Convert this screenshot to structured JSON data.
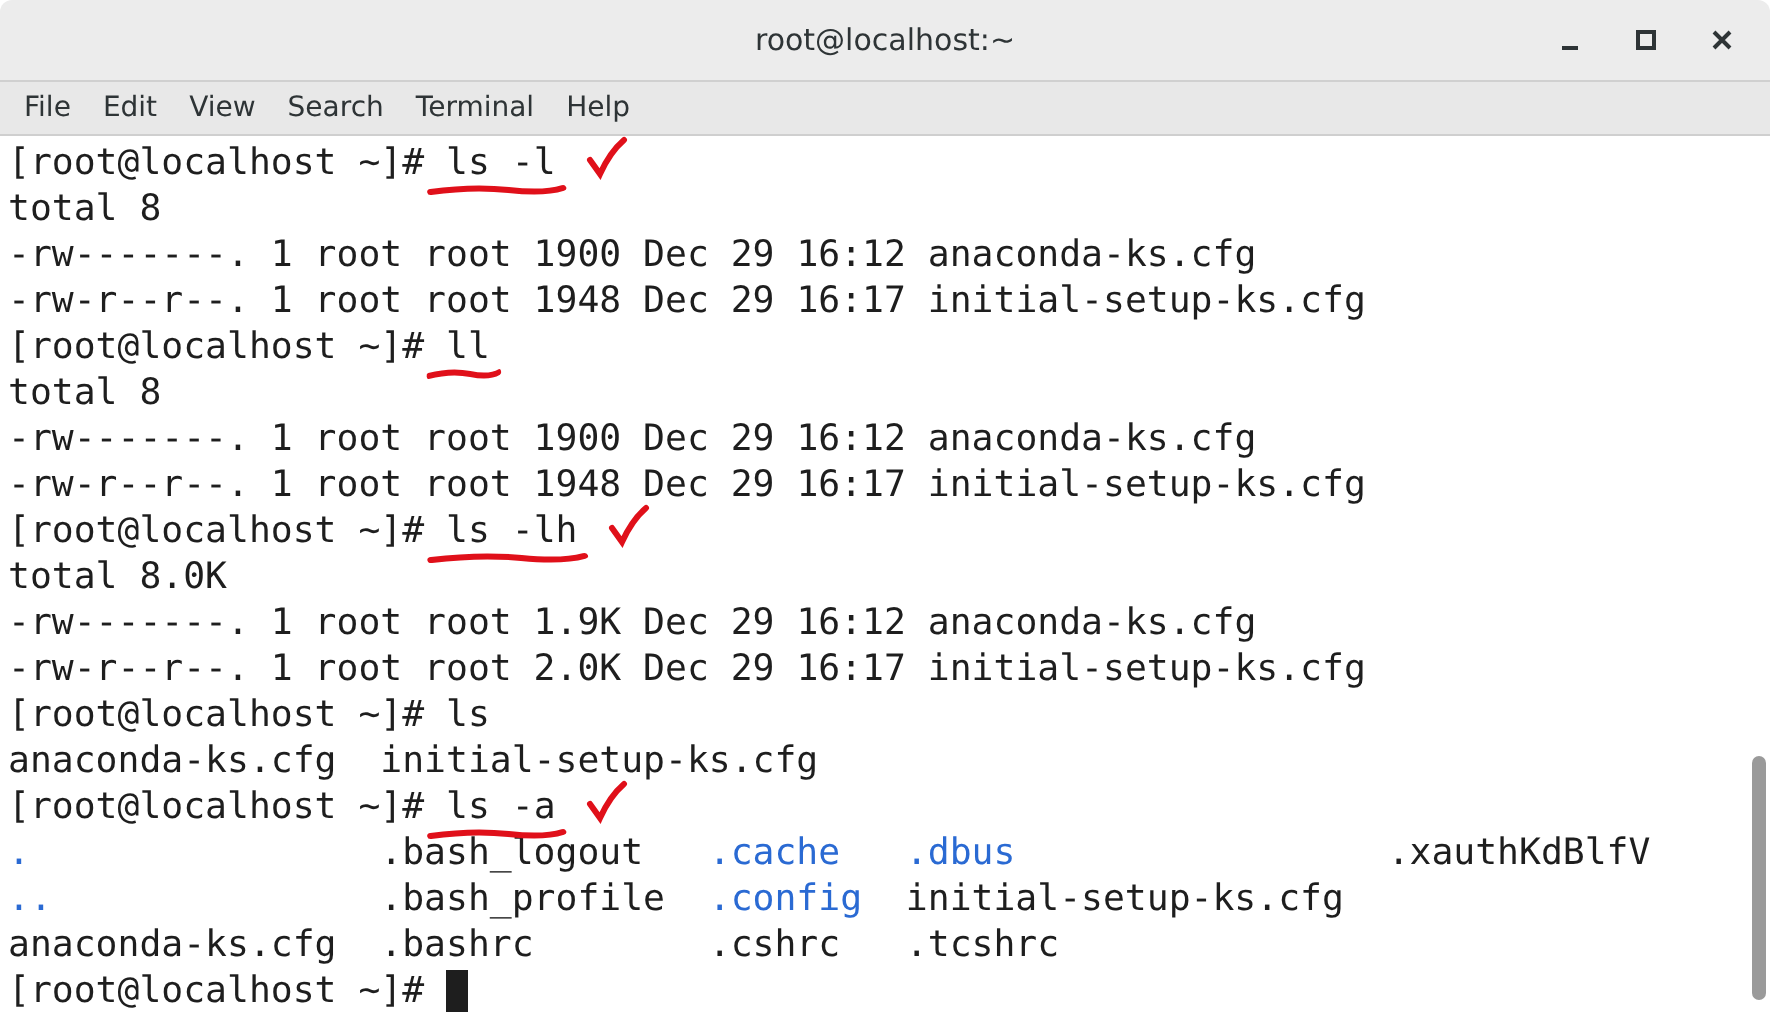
{
  "window": {
    "title": "root@localhost:~"
  },
  "menu": [
    "File",
    "Edit",
    "View",
    "Search",
    "Terminal",
    "Help"
  ],
  "lines": [
    {
      "kind": "prompt",
      "prompt": "[root@localhost ~]#",
      "command": "ls -l",
      "underline": true,
      "check": true,
      "cursor": false
    },
    {
      "kind": "output",
      "text": "total 8"
    },
    {
      "kind": "output",
      "text": "-rw-------. 1 root root 1900 Dec 29 16:12 anaconda-ks.cfg"
    },
    {
      "kind": "output",
      "text": "-rw-r--r--. 1 root root 1948 Dec 29 16:17 initial-setup-ks.cfg"
    },
    {
      "kind": "prompt",
      "prompt": "[root@localhost ~]#",
      "command": "ll",
      "underline": true,
      "check": false,
      "cursor": false
    },
    {
      "kind": "output",
      "text": "total 8"
    },
    {
      "kind": "output",
      "text": "-rw-------. 1 root root 1900 Dec 29 16:12 anaconda-ks.cfg"
    },
    {
      "kind": "output",
      "text": "-rw-r--r--. 1 root root 1948 Dec 29 16:17 initial-setup-ks.cfg"
    },
    {
      "kind": "prompt",
      "prompt": "[root@localhost ~]#",
      "command": "ls -lh",
      "underline": true,
      "check": true,
      "cursor": false
    },
    {
      "kind": "output",
      "text": "total 8.0K"
    },
    {
      "kind": "output",
      "text": "-rw-------. 1 root root 1.9K Dec 29 16:12 anaconda-ks.cfg"
    },
    {
      "kind": "output",
      "text": "-rw-r--r--. 1 root root 2.0K Dec 29 16:17 initial-setup-ks.cfg"
    },
    {
      "kind": "prompt",
      "prompt": "[root@localhost ~]#",
      "command": "ls",
      "underline": false,
      "check": false,
      "cursor": false
    },
    {
      "kind": "columns",
      "cells": [
        {
          "text": "anaconda-ks.cfg",
          "dir": false
        },
        {
          "text": "initial-setup-ks.cfg",
          "dir": false
        }
      ]
    },
    {
      "kind": "prompt",
      "prompt": "[root@localhost ~]#",
      "command": "ls -a",
      "underline": true,
      "check": true,
      "cursor": false
    },
    {
      "kind": "columns",
      "cells": [
        {
          "text": ".",
          "dir": true
        },
        {
          "text": ".bash_logout",
          "dir": false
        },
        {
          "text": ".cache",
          "dir": true
        },
        {
          "text": ".dbus",
          "dir": true
        },
        {
          "text": ".xauthKdBlfV",
          "dir": false
        }
      ]
    },
    {
      "kind": "columns",
      "cells": [
        {
          "text": "..",
          "dir": true
        },
        {
          "text": ".bash_profile",
          "dir": false
        },
        {
          "text": ".config",
          "dir": true
        },
        {
          "text": "initial-setup-ks.cfg",
          "dir": false
        }
      ]
    },
    {
      "kind": "columns",
      "cells": [
        {
          "text": "anaconda-ks.cfg",
          "dir": false
        },
        {
          "text": ".bashrc",
          "dir": false
        },
        {
          "text": ".cshrc",
          "dir": false
        },
        {
          "text": ".tcshrc",
          "dir": false
        }
      ]
    },
    {
      "kind": "prompt",
      "prompt": "[root@localhost ~]#",
      "underline": false,
      "check": false,
      "cursor": true
    }
  ]
}
